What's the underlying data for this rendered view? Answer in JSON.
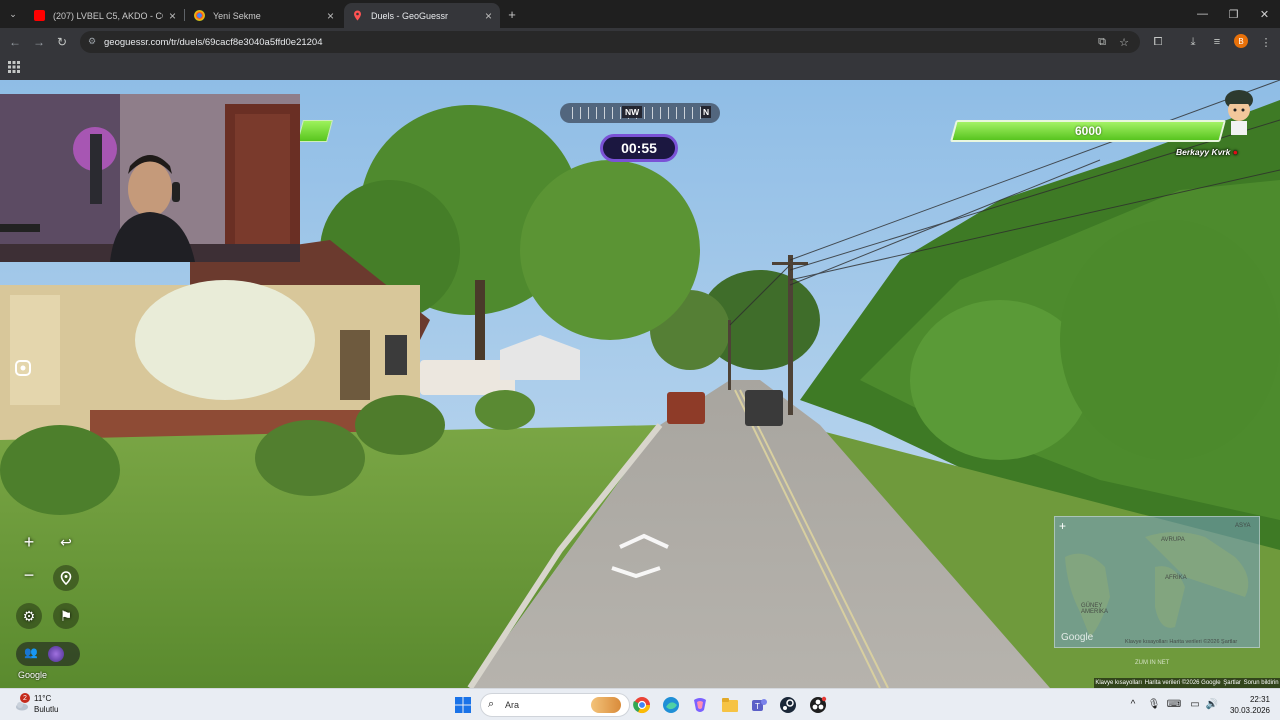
{
  "browser": {
    "tabs": [
      {
        "title": "(207) LVBEL C5, AKDO - COOO",
        "favicon": "youtube-icon"
      },
      {
        "title": "Yeni Sekme",
        "favicon": "chrome-icon"
      },
      {
        "title": "Duels - GeoGuessr",
        "favicon": "geoguessr-pin-icon",
        "active": true
      }
    ],
    "url": "geoguessr.com/tr/duels/69cacf8e3040a5ffd0e21204",
    "profile_initial": "B"
  },
  "game": {
    "opponent_health": "",
    "player_health": "6000",
    "player_name": "Berkayy Kvrk",
    "compass": {
      "primary": "NW",
      "secondary": "N"
    },
    "timer": "00:55",
    "google_label": "Google",
    "minimap": {
      "labels": [
        "AVRUPA",
        "AFRİKA",
        "GÜNEY AMERİKA",
        "ASYA"
      ],
      "footer": "Klavye kısayolları  Harita verileri ©2026  Şartlar",
      "below": "ZUM IN NET"
    },
    "footer_links": [
      "Klavye kısayolları",
      "Harita verileri ©2026 Google",
      "Şartlar",
      "Sorun bildirin"
    ]
  },
  "taskbar": {
    "weather": {
      "temp": "11°C",
      "condition": "Bulutlu",
      "badge": "2"
    },
    "search_placeholder": "Ara",
    "time": "22:31",
    "date": "30.03.2026"
  },
  "colors": {
    "health_green": "#6bd42a",
    "timer_border": "#7a52d6",
    "taskbar_bg": "#e9edf3"
  }
}
